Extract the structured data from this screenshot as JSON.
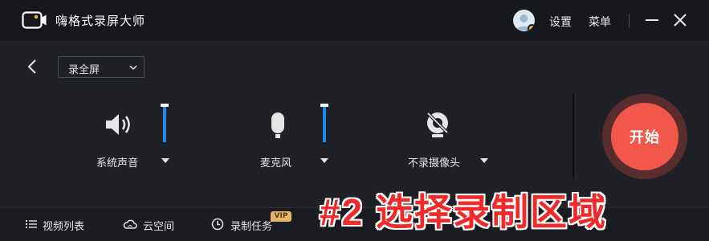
{
  "app": {
    "title": "嗨格式录屏大师"
  },
  "header": {
    "settings_label": "设置",
    "menu_label": "菜单",
    "avatar_icon": "user-avatar-icon",
    "minimize_icon": "minimize-icon",
    "close_icon": "close-icon"
  },
  "toolbar": {
    "back_icon": "chevron-left-icon",
    "mode_select": {
      "value": "录全屏",
      "icon": "chevron-down-icon"
    }
  },
  "controls": {
    "system_sound": {
      "label": "系统声音",
      "icon": "speaker-icon",
      "level": 1.0
    },
    "microphone": {
      "label": "麦克风",
      "icon": "microphone-icon",
      "level": 1.0
    },
    "camera": {
      "label": "不录摄像头",
      "icon": "camera-off-icon"
    }
  },
  "start_button": {
    "label": "开始"
  },
  "bottom_nav": {
    "items": [
      {
        "label": "视频列表",
        "icon": "list-icon"
      },
      {
        "label": "云空间",
        "icon": "cloud-icon"
      },
      {
        "label": "录制任务",
        "icon": "clock-icon",
        "badge": "VIP"
      }
    ]
  },
  "annotation": {
    "text": "#2 选择录制区域"
  },
  "colors": {
    "background": "#1f2126",
    "titlebar": "#17181c",
    "accent_blue": "#1a8bf0",
    "start_red": "#f2574c",
    "vip_gold": "#e7b46a",
    "annotation_red": "#ee2a2a"
  }
}
